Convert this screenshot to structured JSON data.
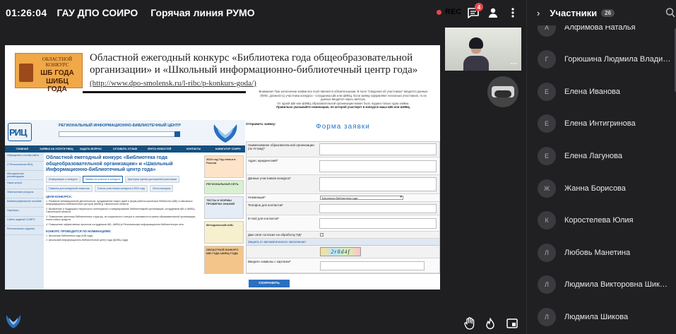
{
  "topbar": {
    "timer": "01:26:04",
    "title": "ГАУ ДПО СОИРО",
    "subtitle": "Горячая линия РУМО",
    "rec_label": "REC",
    "chat_badge": "4",
    "icons": [
      "chat-icon",
      "person-icon",
      "more-vertical-icon"
    ]
  },
  "slide": {
    "logo": {
      "top_text": "ОБЛАСТНОЙ КОНКУРС",
      "line1": "ШБ ГОДА",
      "line2": "ШИБЦ ГОДА"
    },
    "heading": "Областной ежегодный конкурс «Библиотека года общеобразовательной организации» и «Школьный информационно-библиотечный центр года»",
    "link": "(http://www.dpo-smolensk.ru/l-ribc/p-konkurs-goda/)",
    "site": {
      "title": "РЕГИОНАЛЬНЫЙ ИНФОРМАЦИОННО-БИБЛИОТЕЧНЫЙ ЦЕНТР",
      "logo_text": "РИЦ",
      "nav": [
        "ГЛАВНАЯ",
        "ЗАЯВКА НА УСЛУГИ РИБЦ",
        "ЗАДАТЬ ВОПРОС",
        "ОСТАВИТЬ ОТЗЫВ",
        "ЛЕНТА НОВОСТЕЙ",
        "КОНТАКТЫ",
        "НАВИГАТОР СОИРО"
      ],
      "sidebar": [
        "Обращение к гостям сайта",
        "О Региональном ИБЦ",
        "Методические рекомендации",
        "Наши услуги",
        "Электронные ресурсы",
        "Библиографическое пособие",
        "Партнеры",
        "Сайты изданий СОИРО",
        "Региональные издания"
      ],
      "page_heading": "Областной ежегодный конкурс «Библиотека года общеобразовательной организации» и «Школьный Информационно-библиотечный центр года»",
      "tabs": [
        "Информация о конкурсе",
        "Заявка на участие в конкурсе",
        "Критерии оценки достижений участников",
        "Памятка для конкурсной комиссии",
        "Список участников конкурса в 2024 году",
        "Итоги конкурса"
      ],
      "section_title": "ЦЕЛИ КОНКУРСА:",
      "goals": [
        "1. Развитие инновационной деятельности, продвижение новых идей и форм работы школьных библиотек (ШБ) и Школьных информационно-библиотечных центров (ШИБЦ) Смоленской области.",
        "2. Выявление и поддержка творческого потенциала и стимулирование библиотекарей организаций, сотрудников ШБ и ШИБЦ Смоленской области.",
        "3. Повышение престижа библиотечных структур, их социального статуса и значимости в жизни образовательной организации, поиск новых средств.",
        "4. Повышение эффективных проектов сотрудников ШБ, ШИБЦ в Региональную информационно-библиотечную сеть."
      ],
      "nominations_title": "КОНКУРС ПРОВОДИТСЯ ПО НОМИНАЦИЯМ:",
      "nominations": [
        "1. Школьная библиотека года (ШБ года)",
        "2. Школьный информационно-библиотечный центр года (ШИБЦ года)"
      ],
      "banners": [
        "2024 год Год семьи в России",
        "РЕГИОНАЛЬНАЯ СЕТЬ",
        "ТЕСТЫ И ФОРМЫ ПРОВЕРКИ ЗНАНИЙ",
        "Методический кейс",
        "ОБЛАСТНОЙ КОНКУРС ШБ ГОДА ШИБЦ ГОДА"
      ]
    },
    "form": {
      "note_line1": "Внимание! При заполнении заявки все поля являются обязательными. В поле \"Сведения об участниках\" вводятся данные",
      "note_line2": "(ФИО, должность) участника конкурса - сотрудника ШБ или ШИБЦ. Если заявку оформляют несколько участников, то их",
      "note_line3": "данные вводятся через запятую.",
      "note_line4": "От одной ШБ или ШИБЦ образовательной организации может быть подана только одна заявка.",
      "note_line5": "Правильно указывайте номинацию, по которой участвует в конкурсе ваша ШБ или ШИБЦ.",
      "sender_label": "Отправить заявку:",
      "title": "Форма заявки",
      "fields": [
        {
          "label": "Наименование образовательной организации (по Уставу)*"
        },
        {
          "label": "Адрес юридический*"
        },
        {
          "label": "Данные участников конкурса*"
        }
      ],
      "nomination_label": "Номинация*",
      "nomination_value": "Школьная библиотека года",
      "phone_label": "Телефон для контактов*",
      "email_label": "E-mail для контактов*",
      "consent_label": "Даю своё согласие на обработку ПД*",
      "antispam_section": "Защита от автоматического заполнения",
      "captcha_text": "2r8d4f",
      "captcha_label": "Введите символы с картинки*",
      "submit_label": "СОХРАНИТЬ"
    }
  },
  "participants": {
    "title": "Участники",
    "count": "26",
    "list": [
      {
        "initial": "А",
        "name": "Алфимова Наталья"
      },
      {
        "initial": "Г",
        "name": "Горюшина Людмила Владимировна"
      },
      {
        "initial": "Е",
        "name": "Елена Иванова"
      },
      {
        "initial": "Е",
        "name": "Елена Интигринова"
      },
      {
        "initial": "Е",
        "name": "Елена Лагунова"
      },
      {
        "initial": "Ж",
        "name": "Жанна Борисова"
      },
      {
        "initial": "К",
        "name": "Коростелева Юлия"
      },
      {
        "initial": "Л",
        "name": "Любовь Манетина"
      },
      {
        "initial": "Л",
        "name": "Людмила Викторовна Шикова"
      },
      {
        "initial": "Л",
        "name": "Людмила Шикова"
      }
    ]
  },
  "colors": {
    "background": "#1f1f21",
    "panel": "#202022",
    "accent": "#e5484d",
    "form_title": "#2b76c7",
    "site_nav": "#14507f"
  }
}
